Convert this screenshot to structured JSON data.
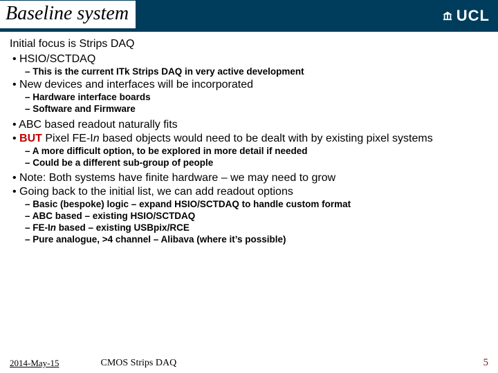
{
  "header": {
    "title": "Baseline system",
    "logo_text": "UCL"
  },
  "content": {
    "lead": "Initial focus is Strips DAQ",
    "b1": "HSIO/SCTDAQ",
    "b1_sub1": "This is the current ITk Strips DAQ in very active development",
    "b2": "New devices and interfaces will be incorporated",
    "b2_sub1": "Hardware interface boards",
    "b2_sub2": "Software and Firmware",
    "b3": "ABC based readout naturally fits",
    "b4_but": "BUT",
    "b4_a": " Pixel FE-I",
    "b4_n": "n",
    "b4_b": " based objects would need to be dealt with by existing pixel systems",
    "b4_sub1": "A more difficult option, to be explored in more detail if needed",
    "b4_sub2": "Could be a different sub-group of people",
    "b5": "Note: Both systems have finite hardware – we may need to grow",
    "b6": "Going back to the initial list, we can add readout options",
    "b6_sub1": "Basic (bespoke) logic – expand HSIO/SCTDAQ to handle custom format",
    "b6_sub2": "ABC based – existing HSIO/SCTDAQ",
    "b6_sub3_a": "FE-I",
    "b6_sub3_n": "n",
    "b6_sub3_b": " based – existing USBpix/RCE",
    "b6_sub4": "Pure analogue, >4 channel –  Alibava (where it’s possible)"
  },
  "footer": {
    "date": "2014-May-15",
    "title": "CMOS Strips DAQ",
    "page": "5"
  }
}
